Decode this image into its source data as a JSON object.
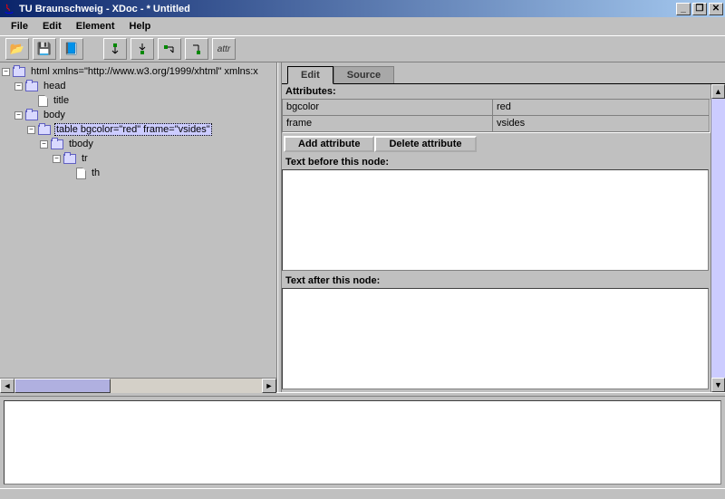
{
  "title": "TU Braunschweig - XDoc - * Untitled",
  "menu": {
    "file": "File",
    "edit": "Edit",
    "element": "Element",
    "help": "Help"
  },
  "toolbar": {
    "open": "📂",
    "save": "💾",
    "doc": "📘",
    "el_before": "↧",
    "el_inside": "⇣",
    "el_after": "↳",
    "el_wrap": "↴",
    "attr": "attr"
  },
  "tree": {
    "root": "html xmlns=\"http://www.w3.org/1999/xhtml\" xmlns:x",
    "head": "head",
    "title": "title",
    "body": "body",
    "table": "table bgcolor=\"red\" frame=\"vsides\"",
    "tbody": "tbody",
    "tr": "tr",
    "th": "th"
  },
  "tabs": {
    "edit": "Edit",
    "source": "Source"
  },
  "panel": {
    "attributes_label": "Attributes:",
    "attrs": [
      {
        "name": "bgcolor",
        "value": "red"
      },
      {
        "name": "frame",
        "value": "vsides"
      }
    ],
    "add_attr": "Add attribute",
    "del_attr": "Delete attribute",
    "text_before": "Text before this node:",
    "text_after": "Text after this node:"
  }
}
